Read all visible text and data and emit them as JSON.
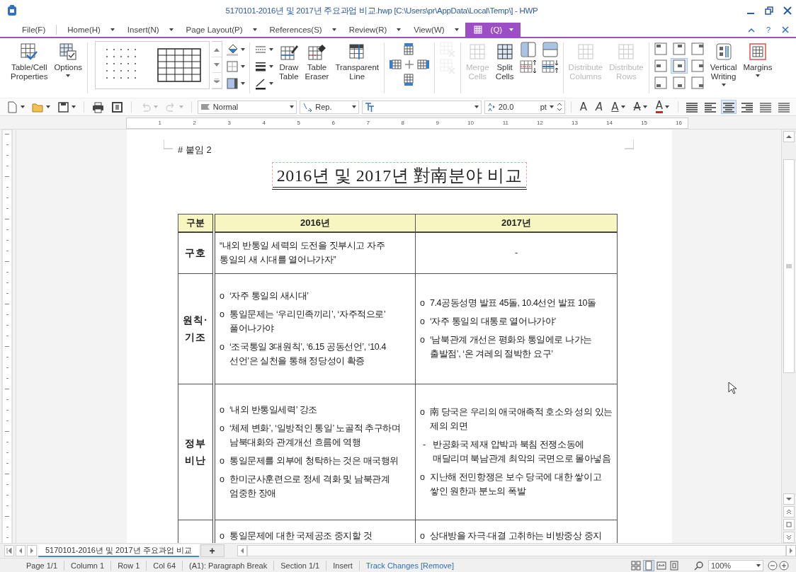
{
  "window": {
    "title": "5170101-2016년 및 2017년 주요과업 비교.hwp [C:\\Users\\pr\\AppData\\Local\\Temp\\] - HWP",
    "help": "?"
  },
  "menu": [
    {
      "label": "File(F)",
      "dropdown": false,
      "selected": false
    },
    {
      "label": "Home(H)",
      "dropdown": true,
      "selected": false
    },
    {
      "label": "Insert(N)",
      "dropdown": true,
      "selected": false
    },
    {
      "label": "Page Layout(P)",
      "dropdown": true,
      "selected": false
    },
    {
      "label": "References(S)",
      "dropdown": true,
      "selected": false
    },
    {
      "label": "Review(R)",
      "dropdown": true,
      "selected": false
    },
    {
      "label": "View(W)",
      "dropdown": true,
      "selected": false
    },
    {
      "label": "(Q)",
      "dropdown": true,
      "selected": true
    }
  ],
  "ribbon": [
    {
      "items": [
        {
          "kind": "large",
          "label": "Table/Cell Properties",
          "disabled": false,
          "dropdown": false
        },
        {
          "kind": "large",
          "label": "Options",
          "disabled": false,
          "dropdown": true
        }
      ]
    },
    {
      "items": [
        {
          "kind": "gallery"
        },
        {
          "kind": "stack",
          "buttons": [
            {
              "disabled": false,
              "dropdown": true
            },
            {
              "disabled": false,
              "dropdown": true
            },
            {
              "disabled": false,
              "dropdown": true
            }
          ]
        }
      ]
    },
    {
      "items": [
        {
          "kind": "stack",
          "buttons": [
            {
              "disabled": false,
              "dropdown": true
            },
            {
              "disabled": false,
              "dropdown": true
            },
            {
              "disabled": false,
              "dropdown": true
            }
          ]
        },
        {
          "kind": "large",
          "label": "Draw Table",
          "disabled": false,
          "dropdown": false
        },
        {
          "kind": "large",
          "label": "Table Eraser",
          "disabled": false,
          "dropdown": false
        },
        {
          "kind": "large",
          "label": "Transparent Line",
          "disabled": false,
          "dropdown": false
        }
      ]
    },
    {
      "items": [
        {
          "kind": "cross",
          "buttons": [
            {
              "disabled": false
            },
            {
              "disabled": false
            },
            {
              "disabled": false
            },
            {
              "disabled": false
            }
          ]
        }
      ]
    },
    {
      "items": [
        {
          "kind": "stack",
          "buttons": [
            {
              "disabled": true,
              "dropdown": false
            },
            {
              "disabled": true,
              "dropdown": false
            }
          ]
        }
      ]
    },
    {
      "items": [
        {
          "kind": "large",
          "label": "Merge Cells",
          "disabled": true,
          "dropdown": false
        },
        {
          "kind": "large",
          "label": "Split Cells",
          "disabled": false,
          "dropdown": false
        },
        {
          "kind": "stack",
          "buttons": [
            {
              "disabled": false,
              "dropdown": false
            },
            {
              "disabled": false,
              "dropdown": false
            }
          ]
        },
        {
          "kind": "stack",
          "buttons": [
            {
              "disabled": false,
              "dropdown": false
            },
            {
              "disabled": false,
              "dropdown": false
            }
          ]
        }
      ]
    },
    {
      "items": [
        {
          "kind": "large",
          "label": "Distribute Columns",
          "disabled": true,
          "dropdown": false
        },
        {
          "kind": "large",
          "label": "Distribute Rows",
          "disabled": true,
          "dropdown": false
        }
      ]
    },
    {
      "items": [
        {
          "kind": "align",
          "cells": [
            {
              "selected": false
            },
            {
              "selected": false
            },
            {
              "selected": false
            },
            {
              "selected": false
            },
            {
              "selected": true
            },
            {
              "selected": false
            },
            {
              "selected": false
            },
            {
              "selected": false
            },
            {
              "selected": false
            }
          ]
        },
        {
          "kind": "large",
          "label": "Vertical Writing",
          "disabled": false,
          "dropdown": true
        },
        {
          "kind": "large",
          "label": "Margins",
          "disabled": false,
          "dropdown": true
        }
      ]
    }
  ],
  "toolbar": {
    "buttons": [
      {
        "disabled": false,
        "dropdown": true
      },
      {
        "disabled": false,
        "dropdown": true
      },
      {
        "disabled": false,
        "dropdown": true
      },
      {
        "disabled": false,
        "dropdown": false
      },
      {
        "disabled": false,
        "dropdown": false
      },
      {
        "disabled": true,
        "dropdown": true
      },
      {
        "disabled": true,
        "dropdown": true
      }
    ],
    "style": "Normal",
    "char_style": "Rep.",
    "size": "20.0",
    "unit": "pt",
    "format": [
      {
        "label": "A",
        "kind": "bold",
        "dropdown": false
      },
      {
        "label": "A",
        "kind": "italic",
        "dropdown": false
      },
      {
        "label": "A",
        "kind": "underline",
        "dropdown": true
      },
      {
        "label": "A",
        "kind": "strike",
        "dropdown": true
      },
      {
        "label": "A",
        "kind": "color",
        "dropdown": true
      }
    ],
    "alignment": [
      {
        "selected": false
      },
      {
        "selected": false
      },
      {
        "selected": true
      },
      {
        "selected": false
      },
      {
        "selected": false
      },
      {
        "selected": false
      }
    ]
  },
  "ruler": [
    "1",
    "2",
    "3",
    "4",
    "5",
    "6",
    "7",
    "8",
    "9",
    "10",
    "11",
    "12",
    "13",
    "14",
    "15",
    "16"
  ],
  "document": {
    "note": "# 붙임 2",
    "title": "2016년 및 2017년 對南분야 비교",
    "table": {
      "columns": [
        "구분",
        "2016년",
        "2017년"
      ],
      "rows": [
        {
          "cells": [
            {
              "text": "구호"
            },
            {
              "paragraphs": [
                {
                  "text": "“내외 반통일 세력의 도전을 짓부시고 자주 통일의 새 시대를 열어나가자”"
                }
              ]
            },
            {
              "paragraphs": [
                {
                  "text": "-",
                  "centered": true
                }
              ]
            }
          ]
        },
        {
          "cells": [
            {
              "text": "원칙·기조"
            },
            {
              "paragraphs": [
                {
                  "marker": "o",
                  "text": "‘자주 통일의 새시대’"
                },
                {
                  "marker": "o",
                  "text": "통일문제는 ‘우리민족끼리’, ‘자주적으로’ 풀어나가야"
                },
                {
                  "marker": "o",
                  "text": "‘조국통일 3대원칙’, ‘6.15 공동선언’, ‘10.4 선언’은 실천을 통해 정당성이 확증"
                }
              ]
            },
            {
              "paragraphs": [
                {
                  "marker": "o",
                  "text": "7.4공동성명 발표 45돌, 10.4선언 발표 10돌"
                },
                {
                  "marker": "o",
                  "text": "‘자주 통일의 대통로 열어나가야’"
                },
                {
                  "marker": "o",
                  "text": "‘남북관계 개선은 평화와 통일에로 나가는 출발점’, ‘온 겨레의 절박한 요구’"
                }
              ]
            }
          ]
        },
        {
          "cells": [
            {
              "text": "정부 비난"
            },
            {
              "paragraphs": [
                {
                  "marker": "o",
                  "text": "‘내외 반통일세력’ 강조"
                },
                {
                  "marker": "o",
                  "text": "‘체제 변화’, ‘일방적인 통일’ 노골적 추구하며 남북대화와 관계개선 흐름에 역행"
                },
                {
                  "marker": "o",
                  "text": "통일문제를 외부에 청탁하는 것은 매국행위"
                },
                {
                  "marker": "o",
                  "text": "한미군사훈련으로 정세 격화 및 남북관계 엄중한 장애"
                }
              ]
            },
            {
              "paragraphs": [
                {
                  "marker": "o",
                  "text": "南 당국은 우리의 애국애족적 호소와 성의 있는 제의 외면"
                },
                {
                  "marker": "-",
                  "text": "반공화국 제재 압박과 북침 전쟁소동에 매달리며 북남관계 최악의 국면으로 몰아넣음"
                },
                {
                  "marker": "o",
                  "text": "지난해 전민항쟁은 보수 당국에 대한 쌓이고 쌓인 원한과 분노의 폭발"
                }
              ]
            }
          ]
        },
        {
          "cells": [
            {
              "text": ""
            },
            {
              "paragraphs": [
                {
                  "marker": "o",
                  "text": "통일문제에 대한 국제공조 중지할 것"
                }
              ]
            },
            {
              "paragraphs": [
                {
                  "marker": "o",
                  "text": "상대방을 자극·대결 고취하는 비방중상 중지"
                }
              ]
            }
          ]
        }
      ]
    }
  },
  "sheet_tabs": [
    {
      "label": "5170101-2016년 및 2017년 주요과업 비교",
      "selected": true
    }
  ],
  "add_tab": "+",
  "status_bar": [
    {
      "text": "Page 1/1",
      "kind": "field"
    },
    {
      "text": "Column 1",
      "kind": "field"
    },
    {
      "text": "Row 1",
      "kind": "field"
    },
    {
      "text": "Col 64",
      "kind": "field"
    },
    {
      "text": "(A1): Paragraph Break",
      "kind": "field"
    },
    {
      "text": "Section 1/1",
      "kind": "field"
    },
    {
      "text": "Insert",
      "kind": "field"
    },
    {
      "text": "Track Changes [Remove]",
      "kind": "link"
    }
  ],
  "views": [
    {
      "selected": false
    },
    {
      "selected": true
    },
    {
      "selected": false
    },
    {
      "selected": false
    }
  ],
  "zoom": "100%"
}
